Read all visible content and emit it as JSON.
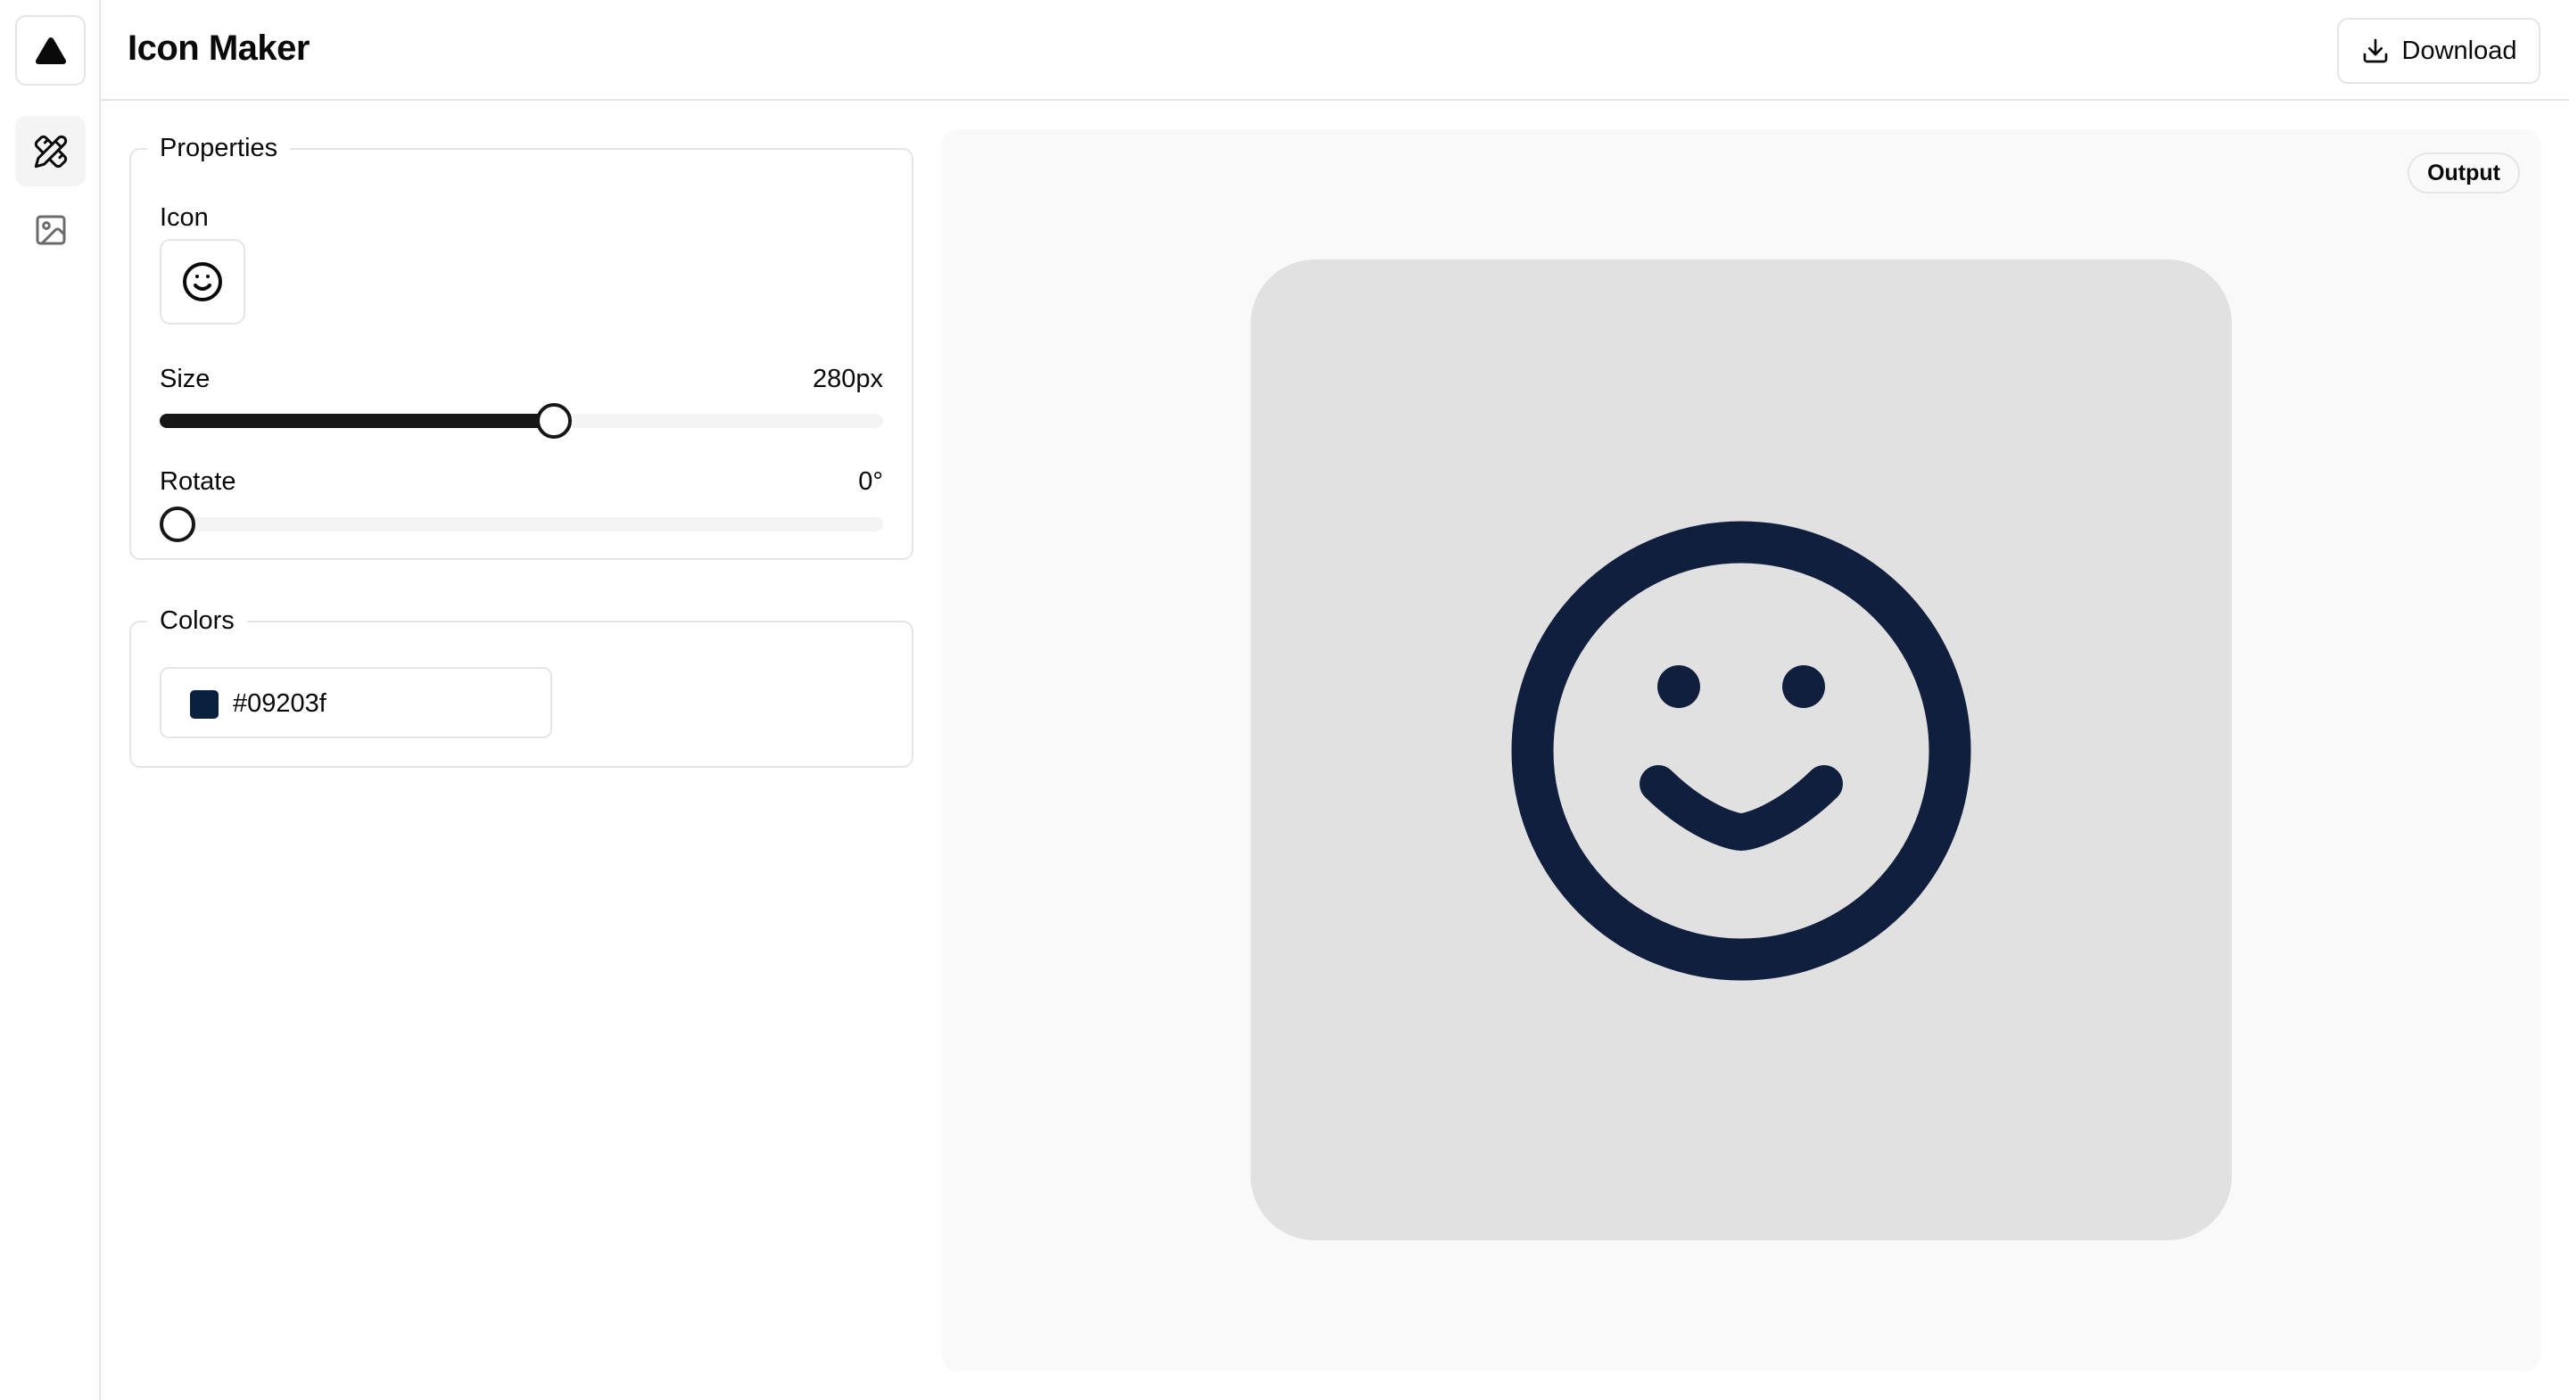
{
  "app": {
    "title": "Icon Maker",
    "logo_icon": "triangle-logo-icon"
  },
  "sidebar": {
    "items": [
      {
        "name": "design",
        "icon": "pencil-ruler-icon",
        "active": true
      },
      {
        "name": "image",
        "icon": "image-icon",
        "active": false
      }
    ]
  },
  "header": {
    "download_label": "Download",
    "download_icon": "download-icon"
  },
  "properties": {
    "legend": "Properties",
    "icon_label": "Icon",
    "icon_value": "smile-icon",
    "size_label": "Size",
    "size_value": "280px",
    "size_fraction": 0.545,
    "rotate_label": "Rotate",
    "rotate_value": "0°",
    "rotate_fraction": 0.0
  },
  "colors": {
    "legend": "Colors",
    "value": "#09203f",
    "swatch_color": "#09203f"
  },
  "output": {
    "badge": "Output",
    "background_color": "#e1e1e1",
    "icon_color": "#0f1f3d",
    "icon": "smile-icon"
  }
}
